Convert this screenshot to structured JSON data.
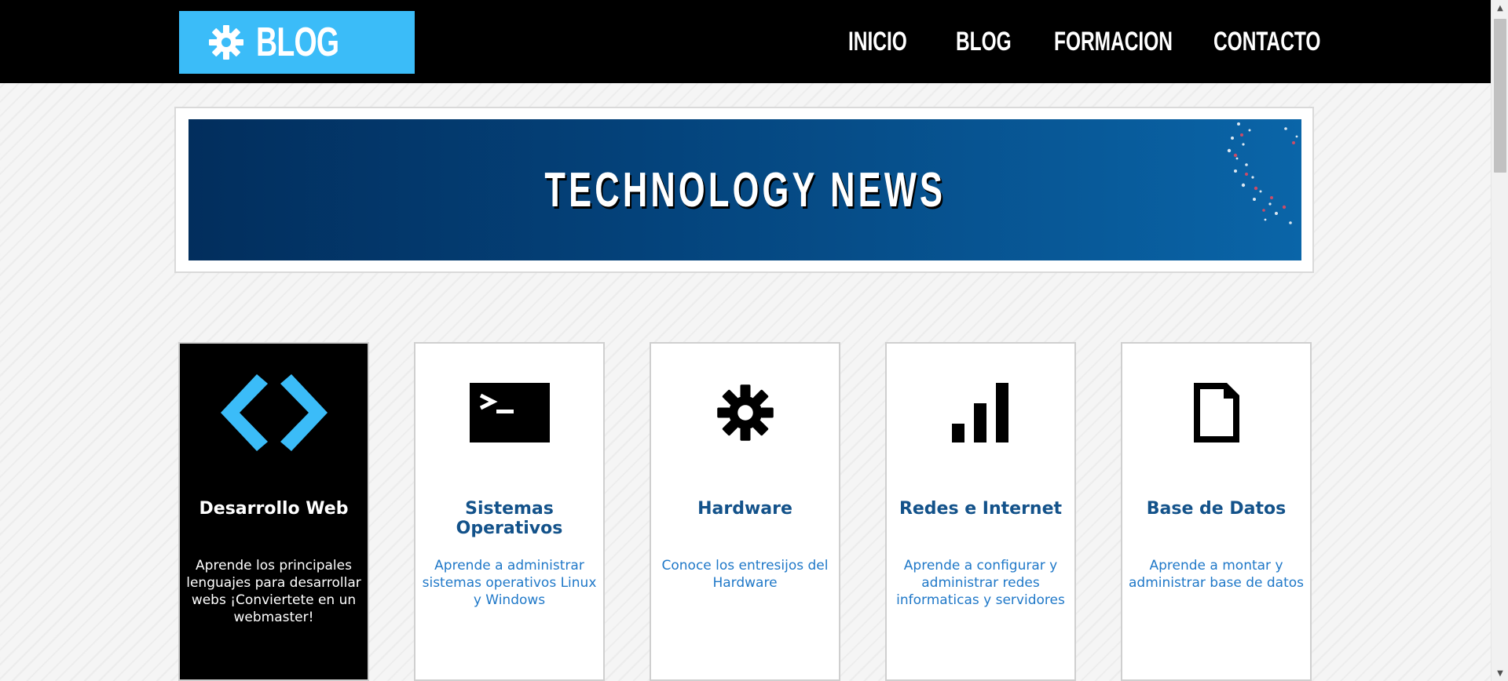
{
  "header": {
    "logo_text": "BLOG",
    "logo_icon": "gear-icon",
    "nav": [
      {
        "label": "INICIO"
      },
      {
        "label": "BLOG"
      },
      {
        "label": "FORMACION"
      },
      {
        "label": "CONTACTO"
      }
    ]
  },
  "banner": {
    "title": "TECHNOLOGY NEWS"
  },
  "cards": [
    {
      "icon": "code-brackets-icon",
      "title": "Desarrollo Web",
      "description": "Aprende los principales lenguajes para desarrollar webs ¡Conviertete en un webmaster!",
      "active": true
    },
    {
      "icon": "terminal-icon",
      "title": "Sistemas Operativos",
      "description": "Aprende a administrar sistemas operativos Linux y Windows",
      "active": false
    },
    {
      "icon": "gear-icon",
      "title": "Hardware",
      "description": "Conoce los entresijos del Hardware",
      "active": false
    },
    {
      "icon": "signal-bars-icon",
      "title": "Redes e Internet",
      "description": "Aprende a configurar y administrar redes informaticas y servidores",
      "active": false
    },
    {
      "icon": "document-icon",
      "title": "Base de Datos",
      "description": "Aprende a montar y administrar base de datos",
      "active": false
    }
  ],
  "colors": {
    "accent": "#3bbcf8",
    "header_bg": "#000000",
    "card_title": "#13528a",
    "card_text": "#1f78c8"
  }
}
